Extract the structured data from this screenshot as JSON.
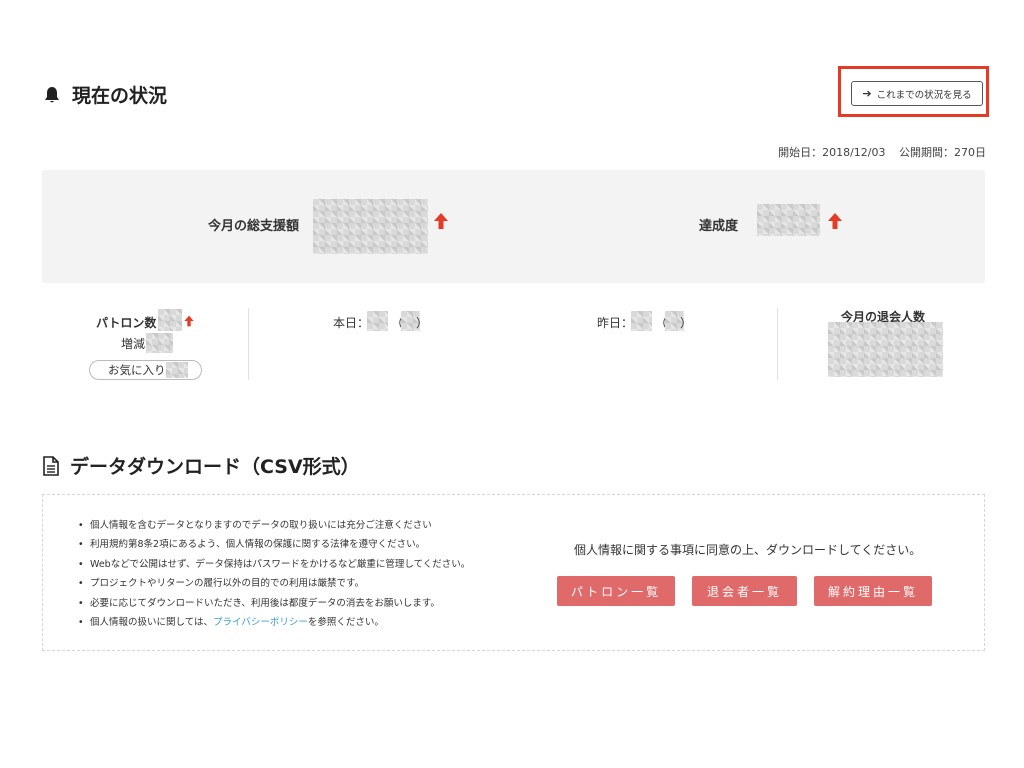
{
  "status_section": {
    "title": "現在の状況",
    "history_button": "これまでの状況を見る",
    "start_date": "開始日：2018/12/03",
    "period": "公開期間：270日"
  },
  "summary": {
    "total_label": "今月の総支援額",
    "achievement_label": "達成度"
  },
  "stats": {
    "patrons_label": "パトロン数",
    "change_label": "増減",
    "favorites_label": "お気に入り:",
    "today_label": "本日：",
    "yesterday_label": "昨日：",
    "open_paren": "（",
    "close_paren": "）",
    "withdrawals_label": "今月の退会人数"
  },
  "download_section": {
    "title": "データダウンロード（CSV形式）",
    "notes": [
      "個人情報を含むデータとなりますのでデータの取り扱いには充分ご注意ください",
      "利用規約第8条2項にあるよう、個人情報の保護に関する法律を遵守ください。",
      "Webなどで公開はせず、データ保持はパスワードをかけるなど厳重に管理してください。",
      "プロジェクトやリターンの履行以外の目的での利用は厳禁です。",
      "必要に応じてダウンロードいただき、利用後は都度データの消去をお願いします。"
    ],
    "privacy_prefix": "個人情報の扱いに関しては、",
    "privacy_link": "プライバシーポリシー",
    "privacy_suffix": "を参照ください。",
    "consent_text": "個人情報に関する事項に同意の上、ダウンロードしてください。",
    "buttons": {
      "patrons": "パトロン一覧",
      "withdrawn": "退会者一覧",
      "reasons": "解約理由一覧"
    }
  },
  "colors": {
    "accent_red": "#e53b26",
    "button_red": "#e06a6a",
    "link_blue": "#3b9fd6"
  },
  "icons": [
    "bell-icon",
    "arrow-right-icon",
    "arrow-up-icon",
    "document-icon"
  ]
}
